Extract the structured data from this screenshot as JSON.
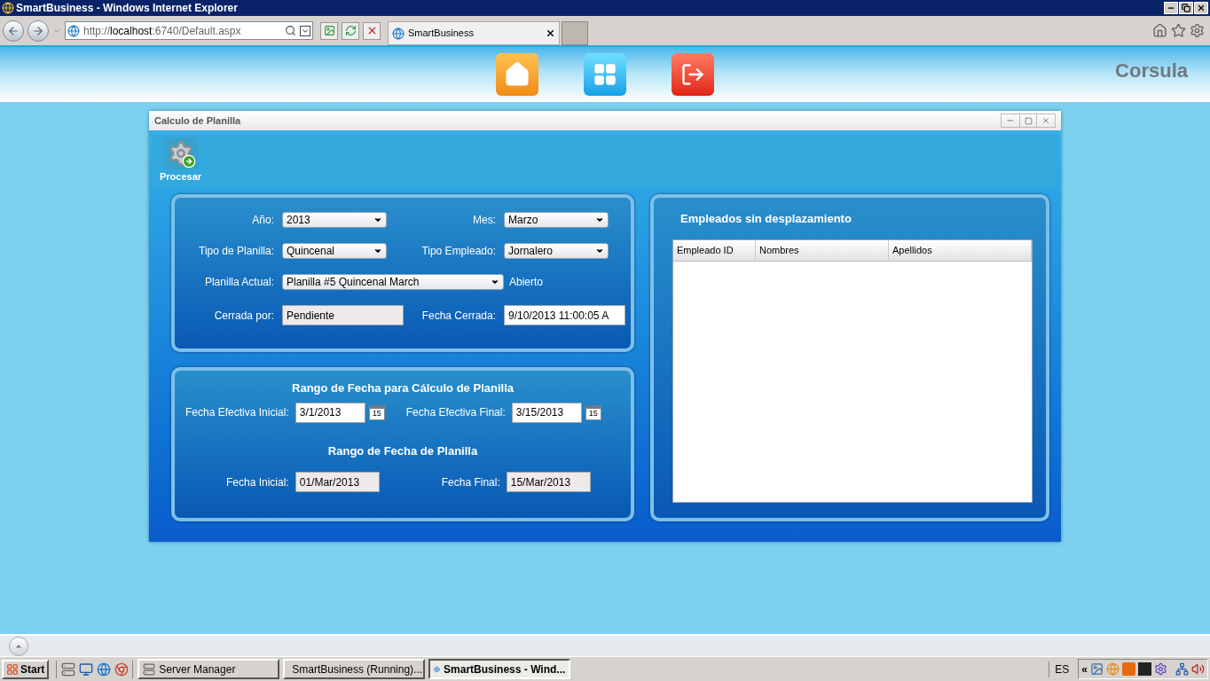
{
  "browser": {
    "title": "SmartBusiness - Windows Internet Explorer",
    "address": {
      "scheme": "http://",
      "host": "localhost",
      "path": ":6740/Default.aspx"
    },
    "tabs": [
      {
        "label": "SmartBusiness",
        "selected": true
      }
    ]
  },
  "header": {
    "brand": "Corsula"
  },
  "window": {
    "title": "Calculo de Planilla",
    "toolbar": [
      {
        "label": "Procesar"
      }
    ]
  },
  "period_form": {
    "rows": [
      [
        {
          "kind": "label",
          "text": "Año:"
        },
        {
          "kind": "select",
          "value": "2013"
        },
        {
          "kind": "label",
          "text": "Mes:"
        },
        {
          "kind": "select",
          "value": "Marzo"
        }
      ],
      [
        {
          "kind": "label",
          "text": "Tipo de Planilla:"
        },
        {
          "kind": "select",
          "value": "Quincenal"
        },
        {
          "kind": "label",
          "text": "Tipo Empleado:"
        },
        {
          "kind": "select",
          "value": "Jornalero"
        }
      ],
      [
        {
          "kind": "label",
          "text": "Planilla Actual:"
        },
        {
          "kind": "wide_select",
          "value": "Planilla #5 Quincenal March"
        },
        "",
        {
          "kind": "status",
          "text": "Abierto"
        }
      ],
      [
        {
          "kind": "label",
          "text": "Cerrada por:"
        },
        {
          "kind": "readonly",
          "value": "Pendiente"
        },
        {
          "kind": "label",
          "text": "Fecha Cerrada:"
        },
        {
          "kind": "text",
          "value": "9/10/2013 11:00:05 A"
        }
      ]
    ]
  },
  "date_ranges": [
    {
      "title": "Rango de Fecha para Cálculo de Planilla",
      "fields": [
        {
          "kind": "date",
          "label": "Fecha Efectiva Inicial:",
          "value": "3/1/2013",
          "calendar_day": "15"
        },
        {
          "kind": "date",
          "label": "Fecha Efectiva Final:",
          "value": "3/15/2013",
          "calendar_day": "15"
        }
      ]
    },
    {
      "title": "Rango de Fecha de Planilla",
      "fields": [
        {
          "kind": "readonly",
          "label": "Fecha Inicial:",
          "value": "01/Mar/2013"
        },
        {
          "kind": "readonly",
          "label": "Fecha Final:",
          "value": "15/Mar/2013"
        }
      ]
    }
  ],
  "employees": {
    "title": "Empleados sin desplazamiento",
    "columns": [
      "Empleado ID",
      "Nombres",
      "Apellidos"
    ]
  },
  "taskbar": {
    "start": "Start",
    "tasks": [
      {
        "label": "Server Manager",
        "selected": false
      },
      {
        "label": "SmartBusiness (Running)...",
        "selected": false
      },
      {
        "label": "SmartBusiness - Wind...",
        "selected": true
      }
    ],
    "tray_expand": "«",
    "language": "ES"
  }
}
